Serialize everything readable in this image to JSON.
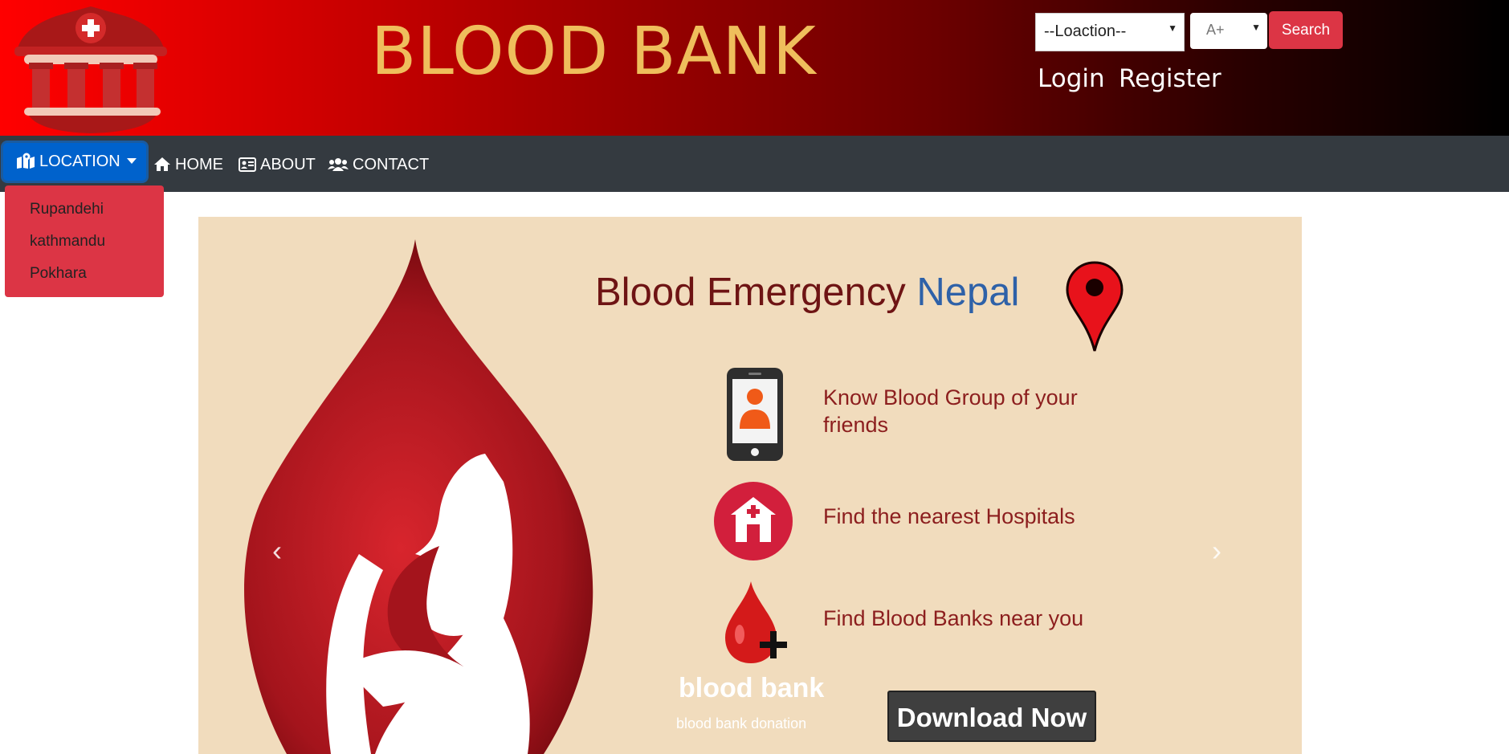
{
  "header": {
    "title": "BLOOD BANK",
    "location_select": "--Loaction--",
    "blood_group_select": "A+",
    "search_label": "Search",
    "login_label": "Login",
    "register_label": "Register"
  },
  "nav": {
    "location_label": "LOCATION",
    "home_label": "HOME",
    "about_label": "ABOUT",
    "contact_label": "CONTACT"
  },
  "dropdown": {
    "items": [
      "Rupandehi",
      "kathmandu",
      "Pokhara"
    ]
  },
  "banner": {
    "title_main": "Blood Emergency ",
    "title_accent": "Nepal",
    "features": [
      "Know Blood Group of your friends",
      "Find the nearest Hospitals",
      "Find Blood Banks near you"
    ],
    "bb_title": "blood bank",
    "bb_subtitle": "blood bank donation",
    "download_label": "Download Now",
    "prev_arrow": "‹",
    "next_arrow": "›"
  },
  "colors": {
    "search_red": "#dc3545",
    "title_gold": "#efbe5c",
    "nav_dark": "#343a40",
    "nav_active_blue": "#0062cc",
    "banner_bg": "#f1dcbd"
  },
  "icons": [
    "blood-bank-logo-icon",
    "map-marked-icon",
    "home-icon",
    "address-card-icon",
    "users-icon",
    "map-pin-icon",
    "phone-user-icon",
    "hospital-icon",
    "blood-drop-plus-icon",
    "mother-baby-drop-illustration"
  ]
}
